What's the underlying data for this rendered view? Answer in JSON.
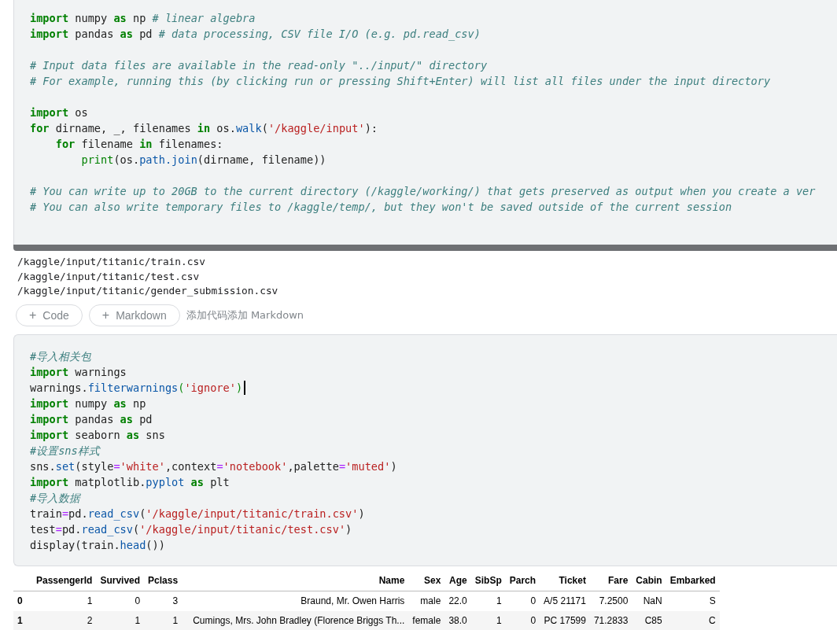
{
  "cells": [
    {
      "kind": "code",
      "lines": [
        {
          "kind": "code",
          "tokens": [
            {
              "kind": "kw",
              "text": "import"
            },
            {
              "kind": "pl",
              "text": " numpy "
            },
            {
              "kind": "kw",
              "text": "as"
            },
            {
              "kind": "pl",
              "text": " np "
            },
            {
              "kind": "cm",
              "text": "# linear algebra"
            }
          ]
        },
        {
          "kind": "code",
          "tokens": [
            {
              "kind": "kw",
              "text": "import"
            },
            {
              "kind": "pl",
              "text": " pandas "
            },
            {
              "kind": "kw",
              "text": "as"
            },
            {
              "kind": "pl",
              "text": " pd "
            },
            {
              "kind": "cm",
              "text": "# data processing, CSV file I/O (e.g. pd.read_csv)"
            }
          ]
        },
        {
          "kind": "blank"
        },
        {
          "kind": "code",
          "tokens": [
            {
              "kind": "cm",
              "text": "# Input data files are available in the read-only \"../input/\" directory"
            }
          ]
        },
        {
          "kind": "code",
          "tokens": [
            {
              "kind": "cm",
              "text": "# For example, running this (by clicking run or pressing Shift+Enter) will list all files under the input directory"
            }
          ]
        },
        {
          "kind": "blank"
        },
        {
          "kind": "code",
          "tokens": [
            {
              "kind": "kw",
              "text": "import"
            },
            {
              "kind": "pl",
              "text": " os"
            }
          ]
        },
        {
          "kind": "code",
          "tokens": [
            {
              "kind": "kw",
              "text": "for"
            },
            {
              "kind": "pl",
              "text": " dirname, _, filenames "
            },
            {
              "kind": "kw",
              "text": "in"
            },
            {
              "kind": "pl",
              "text": " os."
            },
            {
              "kind": "fn",
              "text": "walk"
            },
            {
              "kind": "pl",
              "text": "("
            },
            {
              "kind": "str",
              "text": "'/kaggle/input'"
            },
            {
              "kind": "pl",
              "text": "):"
            }
          ]
        },
        {
          "kind": "code",
          "tokens": [
            {
              "kind": "kw",
              "text": "    for"
            },
            {
              "kind": "pl",
              "text": " filename "
            },
            {
              "kind": "kw",
              "text": "in"
            },
            {
              "kind": "pl",
              "text": " filenames:"
            }
          ]
        },
        {
          "kind": "code",
          "tokens": [
            {
              "kind": "bi",
              "text": "        print"
            },
            {
              "kind": "pl",
              "text": "(os."
            },
            {
              "kind": "fn",
              "text": "path.join"
            },
            {
              "kind": "pl",
              "text": "(dirname, filename))"
            }
          ]
        },
        {
          "kind": "blank"
        },
        {
          "kind": "code",
          "tokens": [
            {
              "kind": "cm",
              "text": "# You can write up to 20GB to the current directory (/kaggle/working/) that gets preserved as output when you create a ver"
            }
          ]
        },
        {
          "kind": "code",
          "tokens": [
            {
              "kind": "cm",
              "text": "# You can also write temporary files to /kaggle/temp/, but they won't be saved outside of the current session"
            }
          ]
        }
      ],
      "output": [
        "/kaggle/input/titanic/train.csv",
        "/kaggle/input/titanic/test.csv",
        "/kaggle/input/titanic/gender_submission.csv"
      ]
    },
    {
      "kind": "add_bar",
      "buttons": [
        {
          "icon": "+",
          "label": "Code"
        },
        {
          "icon": "+",
          "label": "Markdown"
        }
      ],
      "hint": "添加代码添加 Markdown"
    },
    {
      "kind": "code",
      "lines": [
        {
          "kind": "code",
          "tokens": [
            {
              "kind": "cm",
              "text": "#导入相关包"
            }
          ]
        },
        {
          "kind": "code",
          "tokens": [
            {
              "kind": "kw",
              "text": "import"
            },
            {
              "kind": "pl",
              "text": " warnings"
            }
          ]
        },
        {
          "kind": "code",
          "cursor": true,
          "tokens": [
            {
              "kind": "pl",
              "text": "warnings."
            },
            {
              "kind": "fn",
              "text": "filterwarnings"
            },
            {
              "kind": "br",
              "text": "("
            },
            {
              "kind": "str",
              "text": "'ignore'"
            },
            {
              "kind": "br",
              "text": ")"
            }
          ]
        },
        {
          "kind": "code",
          "tokens": [
            {
              "kind": "kw",
              "text": "import"
            },
            {
              "kind": "pl",
              "text": " numpy "
            },
            {
              "kind": "kw",
              "text": "as"
            },
            {
              "kind": "pl",
              "text": " np"
            }
          ]
        },
        {
          "kind": "code",
          "tokens": [
            {
              "kind": "kw",
              "text": "import"
            },
            {
              "kind": "pl",
              "text": " pandas "
            },
            {
              "kind": "kw",
              "text": "as"
            },
            {
              "kind": "pl",
              "text": " pd"
            }
          ]
        },
        {
          "kind": "code",
          "tokens": [
            {
              "kind": "kw",
              "text": "import"
            },
            {
              "kind": "pl",
              "text": " seaborn "
            },
            {
              "kind": "kw",
              "text": "as"
            },
            {
              "kind": "pl",
              "text": " sns"
            }
          ]
        },
        {
          "kind": "code",
          "tokens": [
            {
              "kind": "cm",
              "text": "#设置sns样式"
            }
          ]
        },
        {
          "kind": "code",
          "tokens": [
            {
              "kind": "pl",
              "text": "sns."
            },
            {
              "kind": "fn",
              "text": "set"
            },
            {
              "kind": "pl",
              "text": "(style"
            },
            {
              "kind": "op",
              "text": "="
            },
            {
              "kind": "str",
              "text": "'white'"
            },
            {
              "kind": "pl",
              "text": ",context"
            },
            {
              "kind": "op",
              "text": "="
            },
            {
              "kind": "str",
              "text": "'notebook'"
            },
            {
              "kind": "pl",
              "text": ",palette"
            },
            {
              "kind": "op",
              "text": "="
            },
            {
              "kind": "str",
              "text": "'muted'"
            },
            {
              "kind": "pl",
              "text": ")"
            }
          ]
        },
        {
          "kind": "code",
          "tokens": [
            {
              "kind": "kw",
              "text": "import"
            },
            {
              "kind": "pl",
              "text": " matplotlib."
            },
            {
              "kind": "fn",
              "text": "pyplot"
            },
            {
              "kind": "kw",
              "text": " as"
            },
            {
              "kind": "pl",
              "text": " plt"
            }
          ]
        },
        {
          "kind": "code",
          "tokens": [
            {
              "kind": "cm",
              "text": "#导入数据"
            }
          ]
        },
        {
          "kind": "code",
          "tokens": [
            {
              "kind": "pl",
              "text": "train"
            },
            {
              "kind": "op",
              "text": "="
            },
            {
              "kind": "pl",
              "text": "pd."
            },
            {
              "kind": "fn",
              "text": "read_csv"
            },
            {
              "kind": "pl",
              "text": "("
            },
            {
              "kind": "str",
              "text": "'/kaggle/input/titanic/train.csv'"
            },
            {
              "kind": "pl",
              "text": ")"
            }
          ]
        },
        {
          "kind": "code",
          "tokens": [
            {
              "kind": "pl",
              "text": "test"
            },
            {
              "kind": "op",
              "text": "="
            },
            {
              "kind": "pl",
              "text": "pd."
            },
            {
              "kind": "fn",
              "text": "read_csv"
            },
            {
              "kind": "pl",
              "text": "("
            },
            {
              "kind": "str",
              "text": "'/kaggle/input/titanic/test.csv'"
            },
            {
              "kind": "pl",
              "text": ")"
            }
          ]
        },
        {
          "kind": "code",
          "tokens": [
            {
              "kind": "pl",
              "text": "display(train."
            },
            {
              "kind": "fn",
              "text": "head"
            },
            {
              "kind": "pl",
              "text": "())"
            }
          ]
        }
      ],
      "table": {
        "columns": [
          "PassengerId",
          "Survived",
          "Pclass",
          "Name",
          "Sex",
          "Age",
          "SibSp",
          "Parch",
          "Ticket",
          "Fare",
          "Cabin",
          "Embarked"
        ],
        "rows": [
          {
            "index": "0",
            "cells": [
              "1",
              "0",
              "3",
              "Braund, Mr. Owen Harris",
              "male",
              "22.0",
              "1",
              "0",
              "A/5 21171",
              "7.2500",
              "NaN",
              "S"
            ]
          },
          {
            "index": "1",
            "cells": [
              "2",
              "1",
              "1",
              "Cumings, Mrs. John Bradley (Florence Briggs Th...",
              "female",
              "38.0",
              "1",
              "0",
              "PC 17599",
              "71.2833",
              "C85",
              "C"
            ]
          }
        ]
      }
    }
  ]
}
